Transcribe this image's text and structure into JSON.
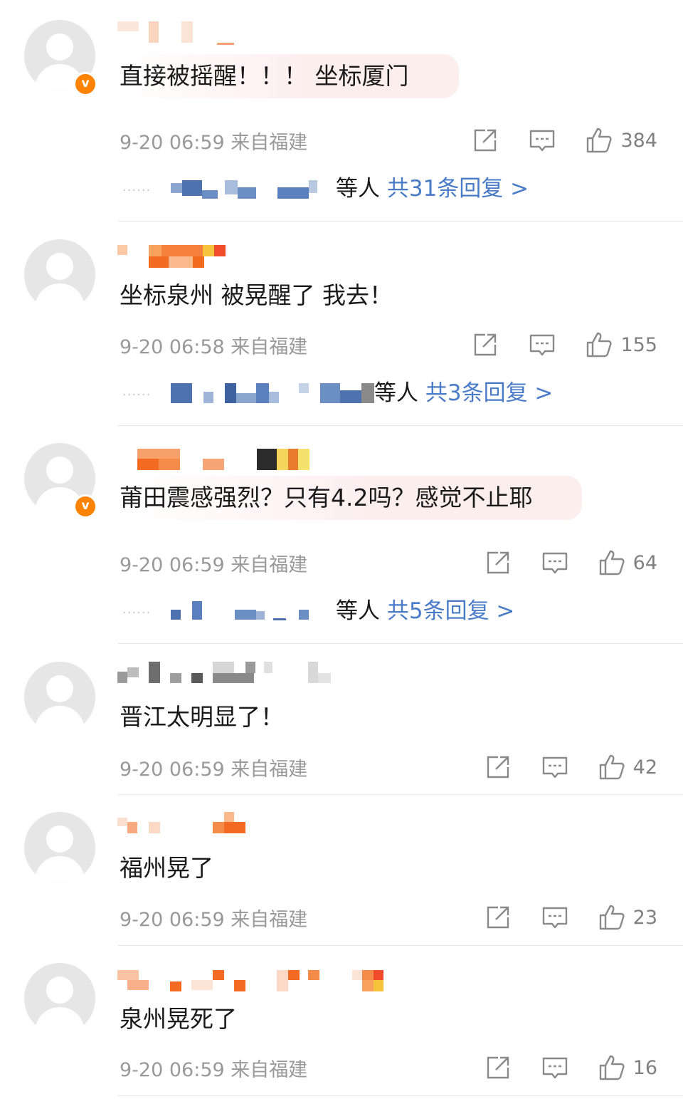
{
  "colors": {
    "link": "#4a7bc7",
    "meta": "#999999",
    "badge": "#ff8200",
    "highlight": "#fdeeee"
  },
  "icons": {
    "share": "share-icon",
    "comment": "comment-icon",
    "like": "thumbs-up-icon",
    "badge": "verified-v-badge-icon"
  },
  "comments": [
    {
      "verified": true,
      "badge_text": "v",
      "content": "直接被摇醒！！！ 坐标厦门",
      "time": "9-20 06:59",
      "source": "来自福建",
      "likes": "384",
      "replies_suffix": "等人",
      "replies_link": "共31条回复 >"
    },
    {
      "verified": false,
      "content": "坐标泉州 被晃醒了 我去！",
      "time": "9-20 06:58",
      "source": "来自福建",
      "likes": "155",
      "replies_suffix": "等人",
      "replies_link": "共3条回复 >"
    },
    {
      "verified": true,
      "badge_text": "v",
      "content": "莆田震感强烈？只有4.2吗？感觉不止耶",
      "time": "9-20 06:59",
      "source": "来自福建",
      "likes": "64",
      "replies_suffix": "等人",
      "replies_link": "共5条回复 >"
    },
    {
      "verified": false,
      "content": "晋江太明显了！",
      "time": "9-20 06:59",
      "source": "来自福建",
      "likes": "42"
    },
    {
      "verified": false,
      "content": "福州晃了",
      "time": "9-20 06:59",
      "source": "来自福建",
      "likes": "23"
    },
    {
      "verified": false,
      "content": "泉州晃死了",
      "time": "9-20 06:59",
      "source": "来自福建",
      "likes": "16"
    }
  ]
}
